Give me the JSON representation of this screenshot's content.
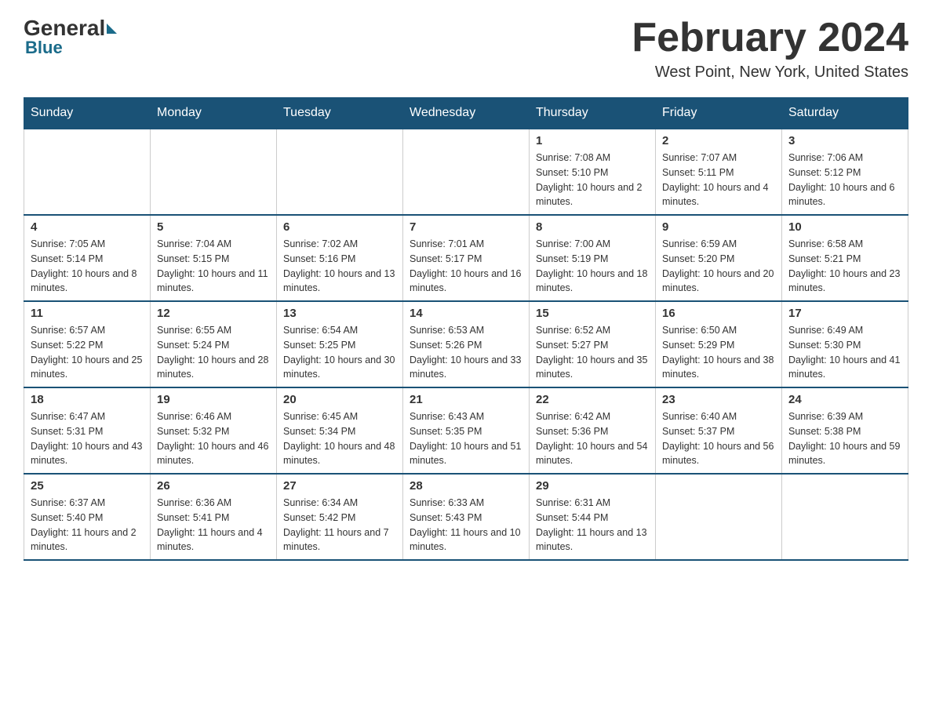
{
  "header": {
    "logo_general": "General",
    "logo_blue": "Blue",
    "month_title": "February 2024",
    "location": "West Point, New York, United States"
  },
  "calendar": {
    "days_of_week": [
      "Sunday",
      "Monday",
      "Tuesday",
      "Wednesday",
      "Thursday",
      "Friday",
      "Saturday"
    ],
    "weeks": [
      [
        {
          "day": "",
          "info": ""
        },
        {
          "day": "",
          "info": ""
        },
        {
          "day": "",
          "info": ""
        },
        {
          "day": "",
          "info": ""
        },
        {
          "day": "1",
          "info": "Sunrise: 7:08 AM\nSunset: 5:10 PM\nDaylight: 10 hours and 2 minutes."
        },
        {
          "day": "2",
          "info": "Sunrise: 7:07 AM\nSunset: 5:11 PM\nDaylight: 10 hours and 4 minutes."
        },
        {
          "day": "3",
          "info": "Sunrise: 7:06 AM\nSunset: 5:12 PM\nDaylight: 10 hours and 6 minutes."
        }
      ],
      [
        {
          "day": "4",
          "info": "Sunrise: 7:05 AM\nSunset: 5:14 PM\nDaylight: 10 hours and 8 minutes."
        },
        {
          "day": "5",
          "info": "Sunrise: 7:04 AM\nSunset: 5:15 PM\nDaylight: 10 hours and 11 minutes."
        },
        {
          "day": "6",
          "info": "Sunrise: 7:02 AM\nSunset: 5:16 PM\nDaylight: 10 hours and 13 minutes."
        },
        {
          "day": "7",
          "info": "Sunrise: 7:01 AM\nSunset: 5:17 PM\nDaylight: 10 hours and 16 minutes."
        },
        {
          "day": "8",
          "info": "Sunrise: 7:00 AM\nSunset: 5:19 PM\nDaylight: 10 hours and 18 minutes."
        },
        {
          "day": "9",
          "info": "Sunrise: 6:59 AM\nSunset: 5:20 PM\nDaylight: 10 hours and 20 minutes."
        },
        {
          "day": "10",
          "info": "Sunrise: 6:58 AM\nSunset: 5:21 PM\nDaylight: 10 hours and 23 minutes."
        }
      ],
      [
        {
          "day": "11",
          "info": "Sunrise: 6:57 AM\nSunset: 5:22 PM\nDaylight: 10 hours and 25 minutes."
        },
        {
          "day": "12",
          "info": "Sunrise: 6:55 AM\nSunset: 5:24 PM\nDaylight: 10 hours and 28 minutes."
        },
        {
          "day": "13",
          "info": "Sunrise: 6:54 AM\nSunset: 5:25 PM\nDaylight: 10 hours and 30 minutes."
        },
        {
          "day": "14",
          "info": "Sunrise: 6:53 AM\nSunset: 5:26 PM\nDaylight: 10 hours and 33 minutes."
        },
        {
          "day": "15",
          "info": "Sunrise: 6:52 AM\nSunset: 5:27 PM\nDaylight: 10 hours and 35 minutes."
        },
        {
          "day": "16",
          "info": "Sunrise: 6:50 AM\nSunset: 5:29 PM\nDaylight: 10 hours and 38 minutes."
        },
        {
          "day": "17",
          "info": "Sunrise: 6:49 AM\nSunset: 5:30 PM\nDaylight: 10 hours and 41 minutes."
        }
      ],
      [
        {
          "day": "18",
          "info": "Sunrise: 6:47 AM\nSunset: 5:31 PM\nDaylight: 10 hours and 43 minutes."
        },
        {
          "day": "19",
          "info": "Sunrise: 6:46 AM\nSunset: 5:32 PM\nDaylight: 10 hours and 46 minutes."
        },
        {
          "day": "20",
          "info": "Sunrise: 6:45 AM\nSunset: 5:34 PM\nDaylight: 10 hours and 48 minutes."
        },
        {
          "day": "21",
          "info": "Sunrise: 6:43 AM\nSunset: 5:35 PM\nDaylight: 10 hours and 51 minutes."
        },
        {
          "day": "22",
          "info": "Sunrise: 6:42 AM\nSunset: 5:36 PM\nDaylight: 10 hours and 54 minutes."
        },
        {
          "day": "23",
          "info": "Sunrise: 6:40 AM\nSunset: 5:37 PM\nDaylight: 10 hours and 56 minutes."
        },
        {
          "day": "24",
          "info": "Sunrise: 6:39 AM\nSunset: 5:38 PM\nDaylight: 10 hours and 59 minutes."
        }
      ],
      [
        {
          "day": "25",
          "info": "Sunrise: 6:37 AM\nSunset: 5:40 PM\nDaylight: 11 hours and 2 minutes."
        },
        {
          "day": "26",
          "info": "Sunrise: 6:36 AM\nSunset: 5:41 PM\nDaylight: 11 hours and 4 minutes."
        },
        {
          "day": "27",
          "info": "Sunrise: 6:34 AM\nSunset: 5:42 PM\nDaylight: 11 hours and 7 minutes."
        },
        {
          "day": "28",
          "info": "Sunrise: 6:33 AM\nSunset: 5:43 PM\nDaylight: 11 hours and 10 minutes."
        },
        {
          "day": "29",
          "info": "Sunrise: 6:31 AM\nSunset: 5:44 PM\nDaylight: 11 hours and 13 minutes."
        },
        {
          "day": "",
          "info": ""
        },
        {
          "day": "",
          "info": ""
        }
      ]
    ]
  }
}
